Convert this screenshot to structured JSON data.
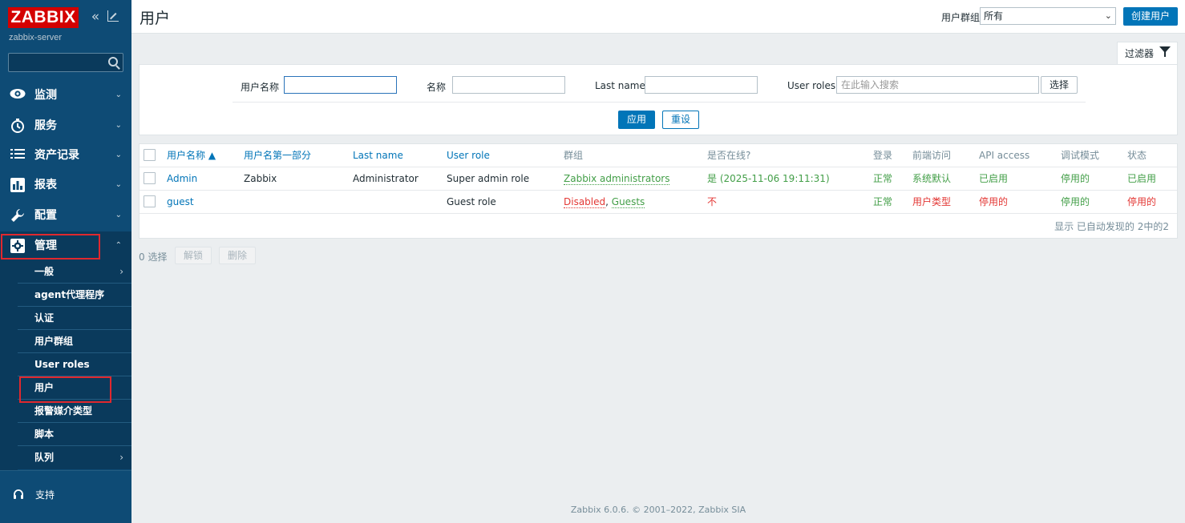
{
  "brand": {
    "logo": "ZABBIX",
    "server": "zabbix-server",
    "collapse_icon": "«"
  },
  "sidebar": {
    "search_placeholder": "",
    "nav": [
      {
        "label": "监测",
        "icon": "eye-icon"
      },
      {
        "label": "服务",
        "icon": "clock-icon"
      },
      {
        "label": "资产记录",
        "icon": "list-icon"
      },
      {
        "label": "报表",
        "icon": "bar-chart-icon"
      },
      {
        "label": "配置",
        "icon": "wrench-icon"
      },
      {
        "label": "管理",
        "icon": "gear-icon"
      }
    ],
    "submenu": [
      {
        "label": "一般",
        "has_children": true
      },
      {
        "label": "agent代理程序",
        "has_children": false
      },
      {
        "label": "认证",
        "has_children": false
      },
      {
        "label": "用户群组",
        "has_children": false
      },
      {
        "label": "User roles",
        "has_children": false
      },
      {
        "label": "用户",
        "has_children": false
      },
      {
        "label": "报警媒介类型",
        "has_children": false
      },
      {
        "label": "脚本",
        "has_children": false
      },
      {
        "label": "队列",
        "has_children": true
      }
    ],
    "bottom": [
      {
        "label": "支持",
        "icon": "headset-icon"
      }
    ]
  },
  "header": {
    "title": "用户",
    "group_label": "用户群组",
    "group_value": "所有",
    "create_button": "创建用户"
  },
  "filter": {
    "tab_label": "过滤器",
    "username_label": "用户名称",
    "username_value": "",
    "name_label": "名称",
    "name_value": "",
    "lastname_label": "Last name",
    "lastname_value": "",
    "roles_label": "User roles",
    "roles_placeholder": "在此输入搜索",
    "select_button": "选择",
    "apply_button": "应用",
    "reset_button": "重设"
  },
  "table": {
    "headers": {
      "username": "用户名称 ▲",
      "name": "用户名第一部分",
      "lastname": "Last name",
      "role": "User role",
      "groups": "群组",
      "online": "是否在线?",
      "login": "登录",
      "frontend": "前端访问",
      "api": "API access",
      "debug": "调试模式",
      "status": "状态"
    },
    "rows": [
      {
        "username": "Admin",
        "name": "Zabbix",
        "lastname": "Administrator",
        "role": "Super admin role",
        "groups": [
          {
            "text": "Zabbix administrators",
            "color": "green"
          }
        ],
        "online": "是 (2025-11-06 19:11:31)",
        "login": "正常",
        "frontend": "系统默认",
        "api": "已启用",
        "debug": "停用的",
        "status": "已启用"
      },
      {
        "username": "guest",
        "name": "",
        "lastname": "",
        "role": "Guest role",
        "groups": [
          {
            "text": "Disabled",
            "color": "red"
          },
          {
            "text": "Guests",
            "color": "green"
          }
        ],
        "groups_sep": ", ",
        "online": "不",
        "login": "正常",
        "frontend": "用户类型",
        "api": "停用的",
        "debug": "停用的",
        "status": "停用的"
      }
    ],
    "footer": "显示 已自动发现的 2中的2"
  },
  "actions": {
    "selected": "0 选择",
    "unlock": "解锁",
    "delete": "删除"
  },
  "footer": "Zabbix 6.0.6. © 2001–2022, Zabbix SIA",
  "colors": {
    "accent": "#0275b8",
    "sidebar": "#0e4b75",
    "green": "#429e47",
    "red": "#e33734",
    "highlight": "#e0282e"
  }
}
